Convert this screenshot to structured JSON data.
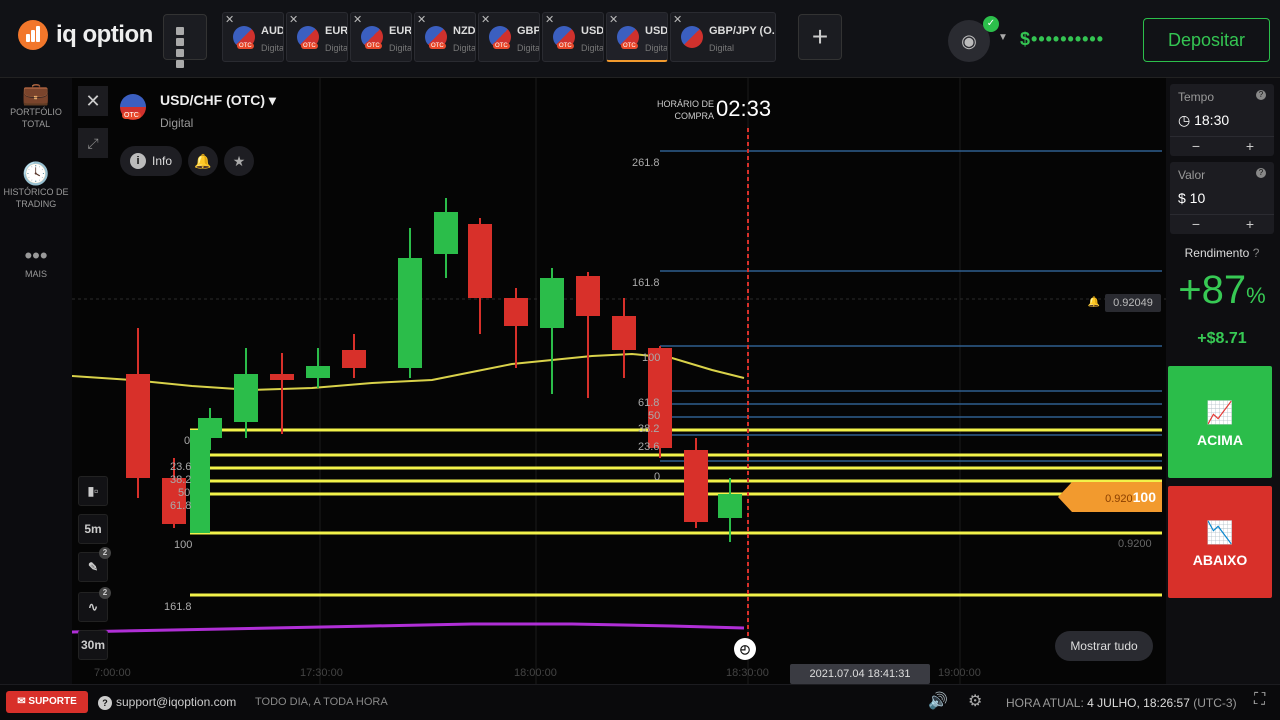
{
  "brand": {
    "name": "iq option"
  },
  "tabs": [
    {
      "name": "AUD",
      "kind": "Digital",
      "otc": "OTC"
    },
    {
      "name": "EUR",
      "kind": "Digital",
      "otc": "OTC"
    },
    {
      "name": "EUR",
      "kind": "Digital",
      "otc": "OTC"
    },
    {
      "name": "NZD",
      "kind": "Digital",
      "otc": "OTC"
    },
    {
      "name": "GBP",
      "kind": "Digital",
      "otc": "OTC"
    },
    {
      "name": "USD",
      "kind": "Digital",
      "otc": "OTC"
    },
    {
      "name": "USD",
      "kind": "Digital",
      "otc": "OTC"
    },
    {
      "name": "GBP/JPY (O...",
      "kind": "Digital",
      "otc": ""
    }
  ],
  "header": {
    "balance": "$••••••••••",
    "deposit_label": "Depositar"
  },
  "sidebar": {
    "portfolio": "PORTFÓLIO TOTAL",
    "history": "HISTÓRICO DE TRADING",
    "more": "MAIS"
  },
  "asset": {
    "name": "USD/CHF (OTC)",
    "type": "Digital",
    "otc": "OTC",
    "info_label": "Info"
  },
  "purchase": {
    "label": "HORÁRIO DE COMPRA",
    "countdown": "02:33"
  },
  "tools": {
    "timeframe": "5m",
    "drawings_count": "2",
    "indicators_count": "2",
    "period": "30m"
  },
  "chart_labels": {
    "fib_top": [
      "261.8",
      "161.8",
      "100",
      "61.8",
      "50",
      "38.2",
      "23.6",
      "0"
    ],
    "fib_left": [
      "0",
      "23.6",
      "38.2",
      "50",
      "61.8",
      "100",
      "161.8"
    ],
    "price_alert": "0.92049",
    "current_price": "0.920",
    "current_price_suffix": "100",
    "low_price": "0.9200",
    "time_ticks": [
      "7:00:00",
      "17:30:00",
      "18:00:00",
      "18:30:00",
      "19:00:00"
    ],
    "timestamp": "2021.07.04 18:41:31",
    "show_all": "Mostrar tudo"
  },
  "trade": {
    "time_label": "Tempo",
    "time_value": "18:30",
    "amount_label": "Valor",
    "amount_value": "$ 10",
    "yield_label": "Rendimento",
    "yield_pct": "+87",
    "yield_pct_sign": "%",
    "yield_amount": "+$8.71",
    "up_label": "ACIMA",
    "down_label": "ABAIXO"
  },
  "footer": {
    "support": "SUPORTE",
    "email": "support@iqoption.com",
    "tagline": "TODO DIA, A TODA HORA",
    "clock_label": "HORA ATUAL:",
    "clock_value": "4 JULHO, 18:26:57",
    "tz": "(UTC-3)"
  },
  "colors": {
    "up": "#2bbd4a",
    "down": "#d8302a",
    "accent": "#f29a2e",
    "fib": "#f2f24a",
    "ma": "#d9d24a",
    "indicator": "#b02fd6"
  }
}
